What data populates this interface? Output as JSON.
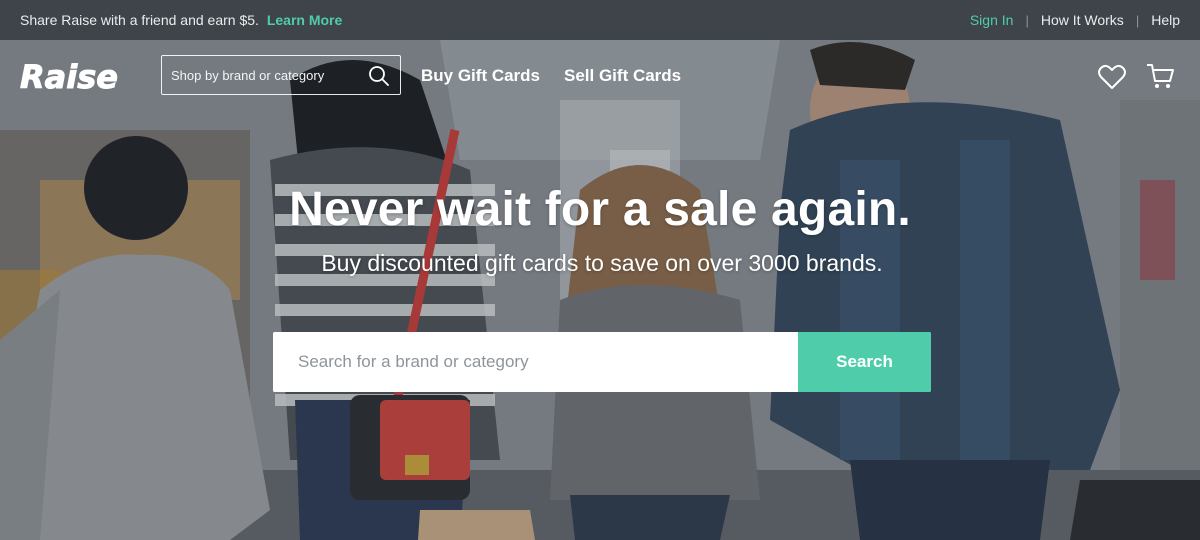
{
  "topbar": {
    "promo_text": "Share Raise with a friend and earn $5.",
    "learn_more": "Learn More",
    "links": [
      "Sign In",
      "How It Works",
      "Help"
    ],
    "separator": "|"
  },
  "header": {
    "logo_text": "Raise",
    "search_placeholder": "Shop by brand or category",
    "nav": [
      "Buy Gift Cards",
      "Sell Gift Cards"
    ]
  },
  "hero": {
    "headline": "Never wait for a sale again.",
    "subhead": "Buy discounted gift cards to save on over 3000 brands.",
    "search_placeholder": "Search for a brand or category",
    "search_button": "Search"
  },
  "colors": {
    "accent": "#4fcdaa",
    "topbar_bg": "#3e4449"
  },
  "icons": [
    "search-icon",
    "heart-icon",
    "cart-icon"
  ]
}
